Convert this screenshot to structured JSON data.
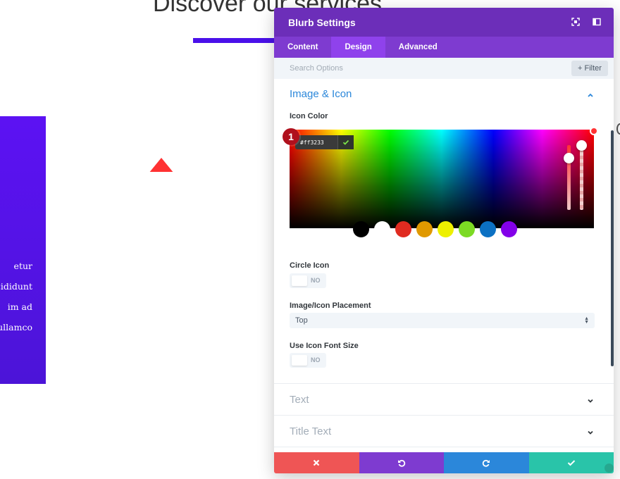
{
  "background": {
    "heading": "Discover our services",
    "card_lines": [
      "etur",
      "cididunt",
      "im ad",
      "ullamco"
    ]
  },
  "modal": {
    "title": "Blurb Settings",
    "header_icons": [
      "focus-icon",
      "split-view-icon"
    ],
    "tabs": [
      {
        "label": "Content",
        "active": false
      },
      {
        "label": "Design",
        "active": true
      },
      {
        "label": "Advanced",
        "active": false
      }
    ],
    "search": {
      "placeholder": "Search Options"
    },
    "filter_label": "Filter",
    "sections": {
      "image_icon": {
        "title": "Image & Icon",
        "icon_color_label": "Icon Color",
        "hex_value": "#ff3233",
        "badge_number": "1",
        "swatches": [
          "#000000",
          "#ffffff",
          "#e02b20",
          "#e09900",
          "#edf000",
          "#7cda24",
          "#0c71c3",
          "#8300e9"
        ],
        "circle_icon_label": "Circle Icon",
        "circle_icon_value": "NO",
        "placement_label": "Image/Icon Placement",
        "placement_value": "Top",
        "font_size_label": "Use Icon Font Size",
        "font_size_value": "NO"
      },
      "text": {
        "title": "Text"
      },
      "title_text": {
        "title": "Title Text"
      }
    },
    "footer": [
      "close-icon",
      "undo-icon",
      "redo-icon",
      "check-icon"
    ]
  },
  "colors": {
    "header": "#6c2eb9",
    "tabs": "#7e3bd0",
    "accent": "#2b87da",
    "icon_color": "#ff3233",
    "cancel": "#ef5555",
    "save": "#29c4a9"
  }
}
